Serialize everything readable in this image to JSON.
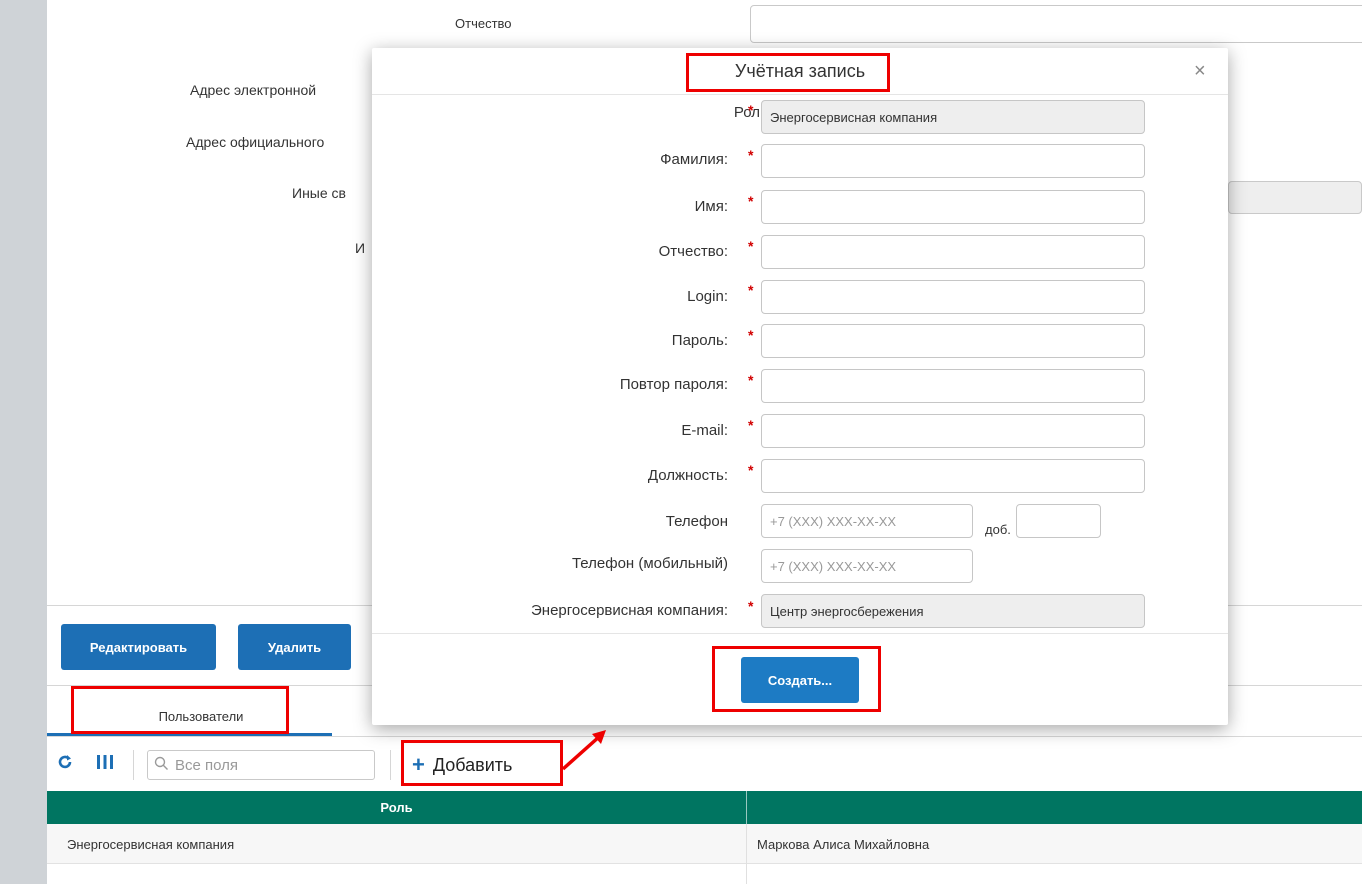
{
  "background": {
    "labels": {
      "patronymic_header": "Отчество",
      "email_address": "Адрес электронной",
      "official_address": "Адрес официального",
      "other_info": "Иные св",
      "other_short": "И"
    },
    "buttons": {
      "edit": "Редактировать",
      "delete": "Удалить"
    },
    "tabs": {
      "users": "Пользователи"
    },
    "toolbar": {
      "refresh_icon": "refresh-icon",
      "columns_icon": "columns-icon",
      "search_placeholder": "Все поля",
      "add_label": "Добавить"
    },
    "table": {
      "columns": [
        "Роль",
        ""
      ],
      "rows": [
        [
          "Энергосервисная компания",
          "Маркова Алиса Михайловна"
        ]
      ]
    }
  },
  "modal": {
    "title": "Учётная запись",
    "close_symbol": "×",
    "fields": {
      "role": {
        "label": "Роль:",
        "value": "Энергосервисная компания"
      },
      "last_name": {
        "label": "Фамилия:",
        "value": ""
      },
      "first_name": {
        "label": "Имя:",
        "value": ""
      },
      "patronymic": {
        "label": "Отчество:",
        "value": ""
      },
      "login": {
        "label": "Login:",
        "value": ""
      },
      "password": {
        "label": "Пароль:",
        "value": ""
      },
      "password_repeat": {
        "label": "Повтор пароля:",
        "value": ""
      },
      "email": {
        "label": "E-mail:",
        "value": ""
      },
      "position": {
        "label": "Должность:",
        "value": ""
      },
      "phone": {
        "label": "Телефон",
        "placeholder": "+7 (XXX) XXX-XX-XX",
        "ext_label": "доб."
      },
      "mobile": {
        "label": "Телефон (мобильный)",
        "placeholder": "+7 (XXX) XXX-XX-XX"
      },
      "company": {
        "label": "Энергосервисная компания:",
        "value": "Центр энергосбережения"
      }
    },
    "required_mark": "*",
    "create_button": "Создать..."
  },
  "colors": {
    "accent": "#1d6fb5",
    "table_header": "#007561",
    "highlight": "#ee0000",
    "required": "#d10000"
  }
}
